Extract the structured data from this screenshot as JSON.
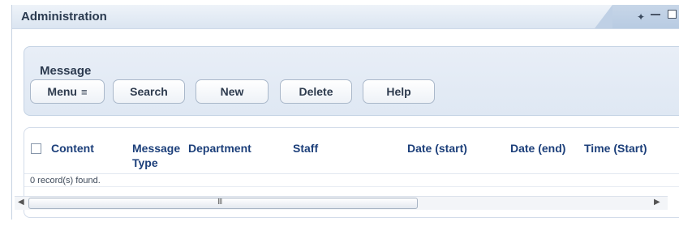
{
  "window": {
    "title": "Administration",
    "icons": [
      "tools-icon",
      "minimize-icon",
      "maximize-icon"
    ]
  },
  "panel": {
    "title": "Message",
    "buttons": {
      "menu": "Menu",
      "menu_icon": "menu-dropdown-icon",
      "search": "Search",
      "new": "New",
      "delete": "Delete",
      "help": "Help"
    }
  },
  "grid": {
    "columns": [
      {
        "line1": "Content",
        "line2": ""
      },
      {
        "line1": "Message",
        "line2": "Type"
      },
      {
        "line1": "Department",
        "line2": ""
      },
      {
        "line1": "Staff",
        "line2": ""
      },
      {
        "line1": "Date (start)",
        "line2": ""
      },
      {
        "line1": "Date (end)",
        "line2": ""
      },
      {
        "line1": "Time (Start)",
        "line2": ""
      }
    ],
    "records_text": "0 record(s) found."
  },
  "scrollbar": {
    "grip": "III"
  },
  "colors": {
    "header_text": "#1c3f7a",
    "panel_bg": "#e3eaf4",
    "titlebar_bg": "#dbe5f1"
  }
}
